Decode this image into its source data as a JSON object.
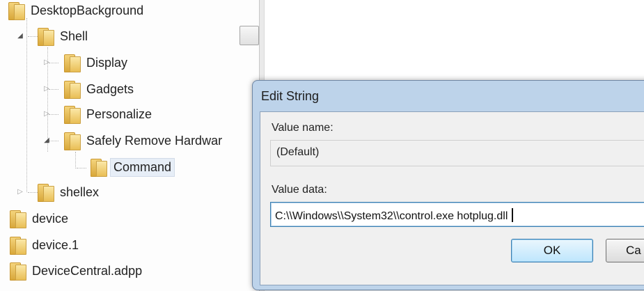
{
  "tree": {
    "items": [
      {
        "label": "DesktopBackground"
      },
      {
        "label": "Shell"
      },
      {
        "label": "Display"
      },
      {
        "label": "Gadgets"
      },
      {
        "label": "Personalize"
      },
      {
        "label": "Safely Remove Hardwar"
      },
      {
        "label": "Command"
      },
      {
        "label": "shellex"
      },
      {
        "label": "device"
      },
      {
        "label": "device.1"
      },
      {
        "label": "DeviceCentral.adpp"
      }
    ]
  },
  "dialog": {
    "title": "Edit String",
    "value_name_label": "Value name:",
    "value_name": "(Default)",
    "value_data_label": "Value data:",
    "value_data": "C:\\\\Windows\\\\System32\\\\control.exe hotplug.dll",
    "ok_label": "OK",
    "cancel_label": "Ca"
  },
  "colors": {
    "dialog_frame": "#bdd3ea",
    "folder": "#e9be55",
    "focus_border": "#3c7fb1"
  },
  "icons": [
    "folder-icon",
    "expander-expanded",
    "expander-collapsed"
  ]
}
